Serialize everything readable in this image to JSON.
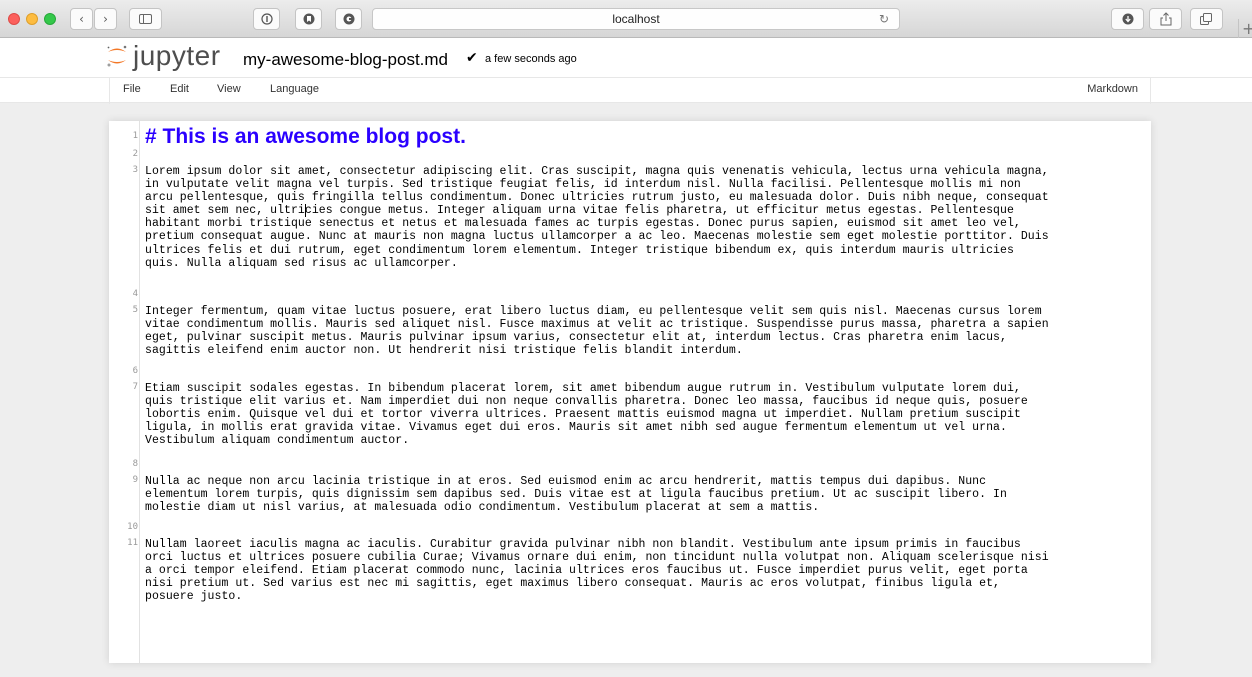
{
  "browser": {
    "url": "localhost",
    "reload_glyph": "↻",
    "icons": [
      "back-icon",
      "forward-icon",
      "sidebar-icon",
      "info-icon",
      "privacy-icon",
      "extension-icon",
      "download-icon",
      "share-icon",
      "tabs-icon",
      "new-tab-icon"
    ]
  },
  "header": {
    "logo_text": "jupyter",
    "filename": "my-awesome-blog-post.md",
    "checkmark": "✔",
    "save_status": "a few seconds ago"
  },
  "menu": {
    "items": [
      "File",
      "Edit",
      "View",
      "Language"
    ],
    "mode": "Markdown"
  },
  "editor": {
    "line_numbers": [
      "1",
      "2",
      "3",
      "4",
      "5",
      "6",
      "7",
      "8",
      "9",
      "10",
      "11"
    ],
    "heading": "# This is an awesome blog post.",
    "paragraphs": [
      "Lorem ipsum dolor sit amet, consectetur adipiscing elit. Cras suscipit, magna quis venenatis vehicula, lectus urna vehicula magna,\nin vulputate velit magna vel turpis. Sed tristique feugiat felis, id interdum nisl. Nulla facilisi. Pellentesque mollis mi non\narcu pellentesque, quis fringilla tellus condimentum. Donec ultricies rutrum justo, eu malesuada dolor. Duis nibh neque, consequat\nsit amet sem nec, ultricies congue metus. Integer aliquam urna vitae felis pharetra, ut efficitur metus egestas. Pellentesque\nhabitant morbi tristique senectus et netus et malesuada fames ac turpis egestas. Donec purus sapien, euismod sit amet leo vel,\npretium consequat augue. Nunc at mauris non magna luctus ullamcorper a ac leo. Maecenas molestie sem eget molestie porttitor. Duis\nultrices felis et dui rutrum, eget condimentum lorem elementum. Integer tristique bibendum ex, quis interdum mauris ultricies\nquis. Nulla aliquam sed risus ac ullamcorper.",
      "Integer fermentum, quam vitae luctus posuere, erat libero luctus diam, eu pellentesque velit sem quis nisl. Maecenas cursus lorem\nvitae condimentum mollis. Mauris sed aliquet nisl. Fusce maximus at velit ac tristique. Suspendisse purus massa, pharetra a sapien\neget, pulvinar suscipit metus. Mauris pulvinar ipsum varius, consectetur elit at, interdum lectus. Cras pharetra enim lacus,\nsagittis eleifend enim auctor non. Ut hendrerit nisi tristique felis blandit interdum.",
      "Etiam suscipit sodales egestas. In bibendum placerat lorem, sit amet bibendum augue rutrum in. Vestibulum vulputate lorem dui,\nquis tristique elit varius et. Nam imperdiet dui non neque convallis pharetra. Donec leo massa, faucibus id neque quis, posuere\nlobortis enim. Quisque vel dui et tortor viverra ultrices. Praesent mattis euismod magna ut imperdiet. Nullam pretium suscipit\nligula, in mollis erat gravida vitae. Vivamus eget dui eros. Mauris sit amet nibh sed augue fermentum elementum ut vel urna.\nVestibulum aliquam condimentum auctor.",
      "Nulla ac neque non arcu lacinia tristique in at eros. Sed euismod enim ac arcu hendrerit, mattis tempus dui dapibus. Nunc\nelementum lorem turpis, quis dignissim sem dapibus sed. Duis vitae est at ligula faucibus pretium. Ut ac suscipit libero. In\nmolestie diam ut nisl varius, at malesuada odio condimentum. Vestibulum placerat at sem a mattis.",
      "Nullam laoreet iaculis magna ac iaculis. Curabitur gravida pulvinar nibh non blandit. Vestibulum ante ipsum primis in faucibus\norci luctus et ultrices posuere cubilia Curae; Vivamus ornare dui enim, non tincidunt nulla volutpat non. Aliquam scelerisque nisi\na orci tempor eleifend. Etiam placerat commodo nunc, lacinia ultrices eros faucibus ut. Fusce imperdiet purus velit, eget porta\nnisi pretium ut. Sed varius est nec mi sagittis, eget maximus libero consequat. Mauris ac eros volutpat, finibus ligula et,\nposuere justo."
    ]
  },
  "colors": {
    "heading": "#2a00ff",
    "logo_orange": "#f37726"
  }
}
